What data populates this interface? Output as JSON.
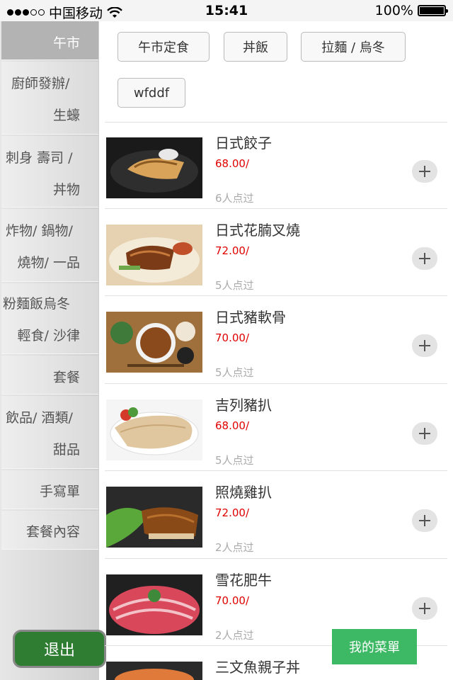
{
  "status_bar": {
    "carrier": "中国移动",
    "time": "15:41",
    "battery": "100%"
  },
  "sidebar": {
    "items": [
      {
        "line1": "午市",
        "line2": ""
      },
      {
        "line1": "廚師發辦/",
        "line2": "生蠔"
      },
      {
        "line1": "刺身 壽司 /",
        "line2": "丼物"
      },
      {
        "line1": "炸物/ 鍋物/",
        "line2": "燒物/ 一品"
      },
      {
        "line1": "粉麵飯烏冬",
        "line2": "輕食/ 沙律"
      },
      {
        "line1": "套餐",
        "line2": ""
      },
      {
        "line1": "飲品/ 酒類/",
        "line2": "甜品"
      },
      {
        "line1": "手寫單",
        "line2": ""
      },
      {
        "line1": "套餐內容",
        "line2": ""
      }
    ],
    "logout_label": "退出"
  },
  "categories": [
    "午市定食",
    "丼飯",
    "拉麵 / 烏冬",
    "wfddf"
  ],
  "dishes": [
    {
      "name": "日式餃子",
      "price": "68.00/",
      "count": "6人点过"
    },
    {
      "name": "日式花腩叉燒",
      "price": "72.00/",
      "count": "5人点过"
    },
    {
      "name": "日式豬軟骨",
      "price": "70.00/",
      "count": "5人点过"
    },
    {
      "name": "吉列豬扒",
      "price": "68.00/",
      "count": "5人点过"
    },
    {
      "name": "照燒雞扒",
      "price": "72.00/",
      "count": "2人点过"
    },
    {
      "name": "雪花肥牛",
      "price": "70.00/",
      "count": "2人点过"
    },
    {
      "name": "三文魚親子丼",
      "price": "",
      "count": ""
    }
  ],
  "my_menu_label": "我的菜單",
  "colors": {
    "price": "#e00000",
    "logout_bg": "#2e7d32",
    "my_menu_bg": "#3db864",
    "sidebar_active": "#b3b3b3"
  },
  "icons": [
    "signal-dots-icon",
    "wifi-icon",
    "battery-icon",
    "plus-icon"
  ]
}
